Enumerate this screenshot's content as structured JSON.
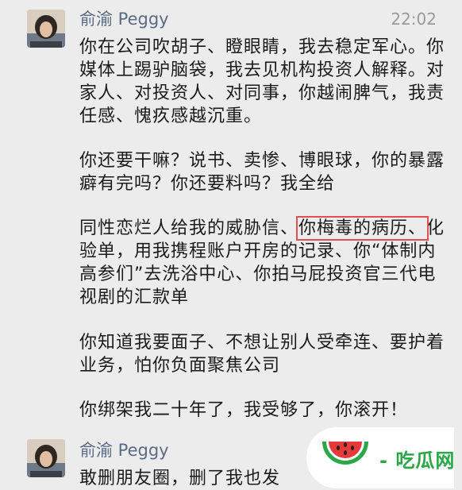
{
  "messages": [
    {
      "sender": "俞渝 Peggy",
      "time": "22:02",
      "paragraphs": [
        "你在公司吹胡子、瞪眼睛，我去稳定军心。你媒体上踢驴脑袋，我去见机构投资人解释。对家人、对投资人、对同事，你越闹脾气，我责任感、愧疚感越沉重。",
        "你还要干嘛？说书、卖惨、博眼球，你的暴露癖有完吗？你还要料吗？我全给",
        {
          "before": "同性恋烂人给我的威胁信、",
          "highlight": "你梅毒的病历、",
          "after": "化验单，用我携程账户开房的记录、你“体制内高参们”去洗浴中心、你拍马屁投资官三代电视剧的汇款单"
        },
        "你知道我要面子、不想让别人受牵连、要护着业务，怕你负面聚焦公司",
        "你绑架我二十年了，我受够了，你滚开！"
      ]
    },
    {
      "sender": "俞渝 Peggy",
      "time": "",
      "paragraphs": [
        "敢删朋友圈，删了我也发"
      ]
    }
  ],
  "watermark": {
    "text": "- 吃瓜网 -",
    "icon": "watermelon-icon"
  },
  "colors": {
    "background": "#ececec",
    "sender": "#5a6b84",
    "highlight_border": "#e05050",
    "watermark_green": "#2aa847"
  }
}
